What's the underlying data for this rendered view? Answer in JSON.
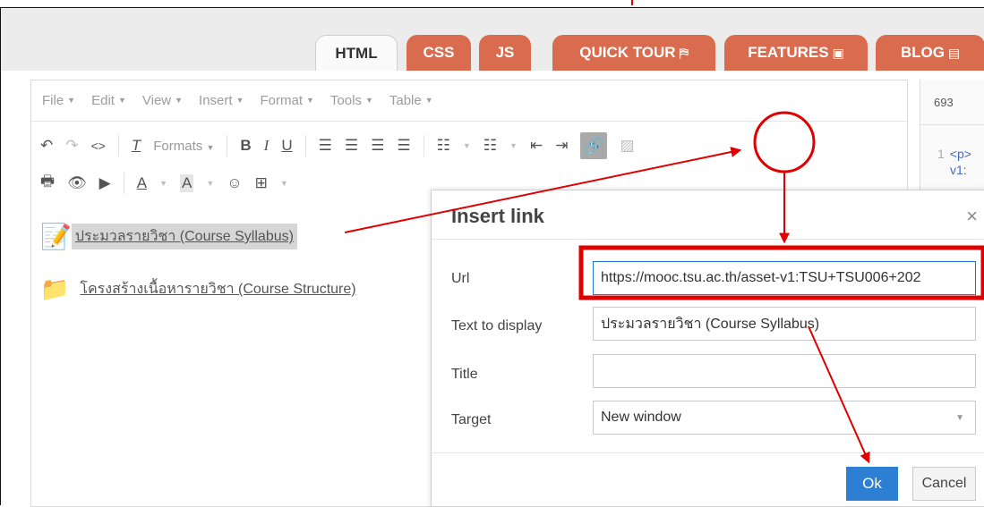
{
  "tabs": [
    {
      "label": "HTML",
      "active": true
    },
    {
      "label": "CSS"
    },
    {
      "label": "JS"
    },
    {
      "label": "QUICK TOUR",
      "icon": "signpost-icon"
    },
    {
      "label": "FEATURES",
      "icon": "toolbox-icon"
    },
    {
      "label": "BLOG",
      "icon": "book-icon"
    }
  ],
  "menu": [
    {
      "label": "File"
    },
    {
      "label": "Edit"
    },
    {
      "label": "View"
    },
    {
      "label": "Insert"
    },
    {
      "label": "Format"
    },
    {
      "label": "Tools"
    },
    {
      "label": "Table"
    }
  ],
  "toolbar": {
    "formats_label": "Formats"
  },
  "content": {
    "item1": "ประมวลรายวิชา (Course Syllabus)",
    "item2": "โครงสร้างเนื้อหารายวิชา (Course Structure)"
  },
  "right_pane": {
    "number": "693",
    "code_line_no": "1",
    "code_line1": "<p>",
    "code_line2": "v1:"
  },
  "dialog": {
    "title": "Insert link",
    "close": "×",
    "url_label": "Url",
    "url_value": "https://mooc.tsu.ac.th/asset-v1:TSU+TSU006+202",
    "text_label": "Text to display",
    "text_value": "ประมวลรายวิชา (Course Syllabus)",
    "title_label": "Title",
    "title_value": "",
    "target_label": "Target",
    "target_value": "New window",
    "ok": "Ok",
    "cancel": "Cancel"
  },
  "colors": {
    "tab_orange": "#d96c4f",
    "annotation_red": "#e00000",
    "ok_blue": "#2d7fd3"
  }
}
